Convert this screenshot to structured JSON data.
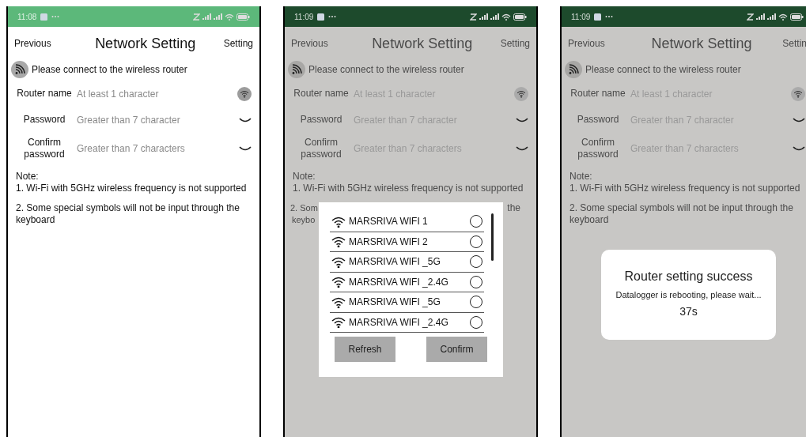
{
  "screens": [
    {
      "dimmed": false,
      "status_bar": {
        "time": "11:08"
      },
      "header": {
        "back": "Previous",
        "title": "Network Setting",
        "action": "Setting"
      },
      "banner": "Please connect to the wireless router",
      "fields": [
        {
          "label": "Router name",
          "placeholder": "At least 1 character",
          "kind": "wifi"
        },
        {
          "label": "Password",
          "placeholder": "Greater than 7 character",
          "kind": "dropdown"
        },
        {
          "label": "Confirm password",
          "placeholder": "Greater than 7 characters",
          "kind": "dropdown"
        }
      ],
      "note": {
        "title": "Note:",
        "items": [
          {
            "kind": "full",
            "text": "1. Wi-Fi with 5GHz wireless frequency is not supported"
          },
          {
            "kind": "full",
            "text": "2. Some special symbols will not be input through the keyboard"
          }
        ]
      }
    },
    {
      "dimmed": true,
      "status_bar": {
        "time": "11:09"
      },
      "header": {
        "back": "Previous",
        "title": "Network Setting",
        "action": "Setting"
      },
      "banner": "Please connect to the wireless router",
      "fields": [
        {
          "label": "Router name",
          "placeholder": "At least 1 character",
          "kind": "wifi"
        },
        {
          "label": "Password",
          "placeholder": "Greater than 7 character",
          "kind": "dropdown"
        },
        {
          "label": "Confirm password",
          "placeholder": "Greater than 7 characters",
          "kind": "dropdown"
        }
      ],
      "note": {
        "title": "Note:",
        "items": [
          {
            "kind": "full",
            "text": "1. Wi-Fi with 5GHz wireless frequency is not supported"
          },
          {
            "kind": "partial",
            "fragments": [
              "2. Som",
              "the",
              "keybo"
            ]
          }
        ]
      },
      "overlay": {
        "kind": "wifi_list",
        "networks": [
          {
            "name": "MARSRIVA WIFI 1",
            "selected": false
          },
          {
            "name": "MARSRIVA WIFI 2",
            "selected": false
          },
          {
            "name": "MARSRIVA WIFI _5G",
            "selected": false
          },
          {
            "name": "MARSRIVA WIFI _2.4G",
            "selected": false
          },
          {
            "name": "MARSRIVA WIFI _5G",
            "selected": false
          },
          {
            "name": "MARSRIVA WIFI _2.4G",
            "selected": false
          }
        ],
        "buttons": [
          "Refresh",
          "Confirm"
        ]
      }
    },
    {
      "dimmed": true,
      "status_bar": {
        "time": "11:09"
      },
      "header": {
        "back": "Previous",
        "title": "Network Setting",
        "action": "Settin"
      },
      "banner": "Please connect to the wireless router",
      "fields": [
        {
          "label": "Router name",
          "placeholder": "At least 1 character",
          "kind": "wifi"
        },
        {
          "label": "Password",
          "placeholder": "Greater than 7 character",
          "kind": "dropdown"
        },
        {
          "label": "Confirm password",
          "placeholder": "Greater than 7 characters",
          "kind": "dropdown"
        }
      ],
      "note": {
        "title": "Note:",
        "items": [
          {
            "kind": "full",
            "text": "1. Wi-Fi with 5GHz wireless frequency is not supported"
          },
          {
            "kind": "full",
            "text": "2. Some special symbols will not be input through the keyboard"
          }
        ]
      },
      "overlay": {
        "kind": "message",
        "title": "Router setting success",
        "message": "Datalogger is rebooting, please wait...",
        "countdown": "37s"
      }
    }
  ]
}
